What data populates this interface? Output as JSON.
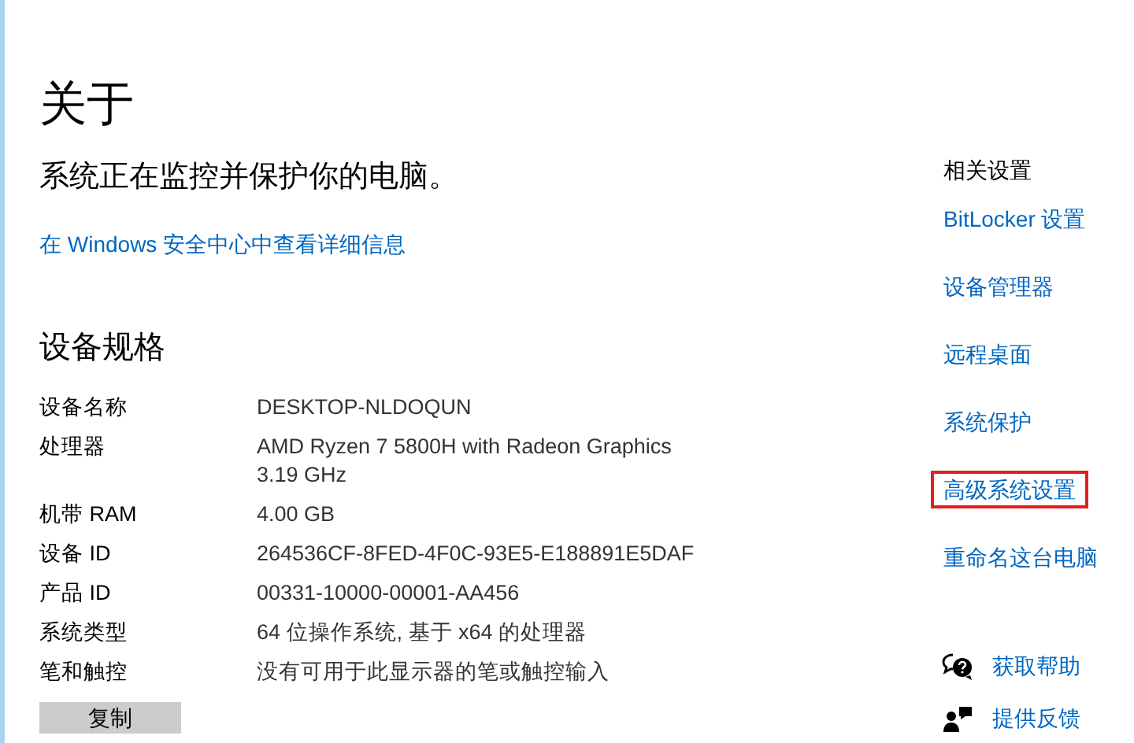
{
  "title": "关于",
  "protection_status": "系统正在监控并保护你的电脑。",
  "security_link": "在 Windows 安全中心中查看详细信息",
  "specs": {
    "heading": "设备规格",
    "rows": [
      {
        "label": "设备名称",
        "value": [
          "DESKTOP-NLDOQUN"
        ]
      },
      {
        "label": "处理器",
        "value": [
          "AMD Ryzen 7 5800H with Radeon Graphics",
          "3.19 GHz"
        ]
      },
      {
        "label": "机带 RAM",
        "value": [
          "4.00 GB"
        ]
      },
      {
        "label": "设备 ID",
        "value": [
          "264536CF-8FED-4F0C-93E5-E188891E5DAF"
        ]
      },
      {
        "label": "产品 ID",
        "value": [
          "00331-10000-00001-AA456"
        ]
      },
      {
        "label": "系统类型",
        "value": [
          "64 位操作系统, 基于 x64 的处理器"
        ]
      },
      {
        "label": "笔和触控",
        "value": [
          "没有可用于此显示器的笔或触控输入"
        ]
      }
    ],
    "copy_button": "复制"
  },
  "related_settings": {
    "heading": "相关设置",
    "links": [
      {
        "label": "BitLocker 设置",
        "highlighted": false
      },
      {
        "label": "设备管理器",
        "highlighted": false
      },
      {
        "label": "远程桌面",
        "highlighted": false
      },
      {
        "label": "系统保护",
        "highlighted": false
      },
      {
        "label": "高级系统设置",
        "highlighted": true
      },
      {
        "label": "重命名这台电脑",
        "highlighted": false
      }
    ]
  },
  "help": [
    {
      "kind": "help",
      "label": "获取帮助"
    },
    {
      "kind": "feedback",
      "label": "提供反馈"
    }
  ]
}
